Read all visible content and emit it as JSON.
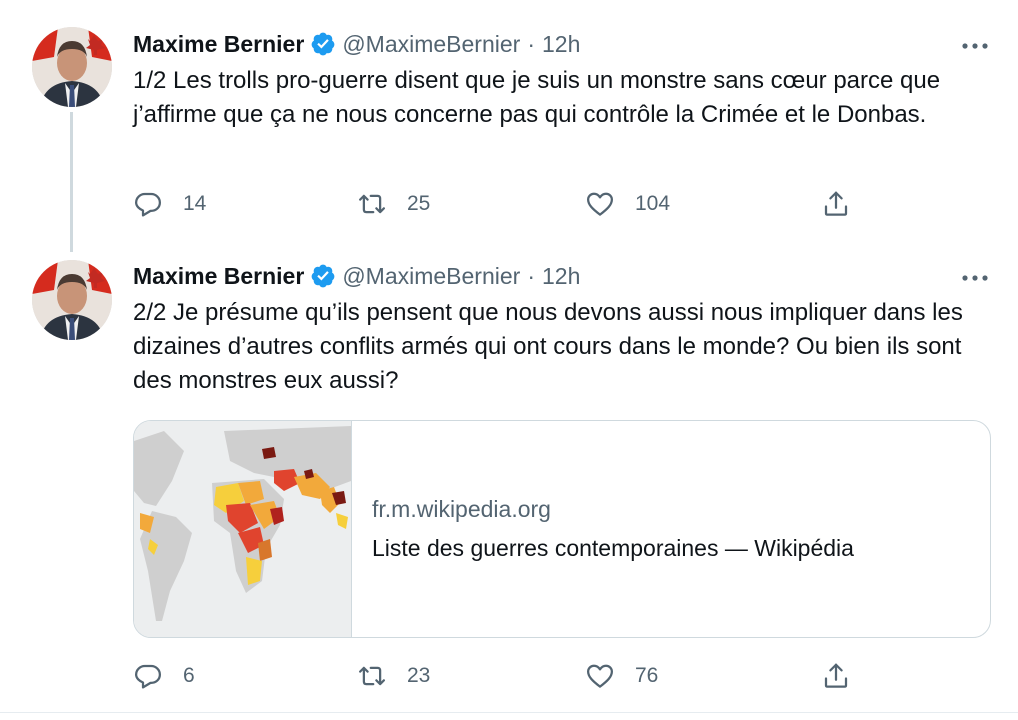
{
  "tweets": [
    {
      "author_name": "Maxime Bernier",
      "handle": "@MaximeBernier",
      "separator": "·",
      "time": "12h",
      "text": "1/2 Les trolls pro-guerre disent que je suis un monstre sans cœur parce que j’affirme que ça ne nous concerne pas qui contrôle la Crimée et le Donbas.",
      "replies": "14",
      "retweets": "25",
      "likes": "104"
    },
    {
      "author_name": "Maxime Bernier",
      "handle": "@MaximeBernier",
      "separator": "·",
      "time": "12h",
      "text": "2/2 Je présume qu’ils pensent que nous devons aussi nous impliquer dans les dizaines d’autres conflits armés qui ont cours dans le monde? Ou bien ils sont des monstres eux aussi?",
      "card": {
        "domain": "fr.m.wikipedia.org",
        "title": "Liste des guerres contemporaines — Wikipédia"
      },
      "replies": "6",
      "retweets": "23",
      "likes": "76"
    }
  ],
  "icons": {
    "verified": "verified-badge-icon",
    "more": "more-horizontal-icon",
    "reply": "reply-icon",
    "retweet": "retweet-icon",
    "like": "heart-icon",
    "share": "share-icon"
  },
  "colors": {
    "verified_blue": "#1d9bf0",
    "secondary_text": "#536471",
    "border": "#cfd9de",
    "flag_red": "#d52b1e"
  }
}
